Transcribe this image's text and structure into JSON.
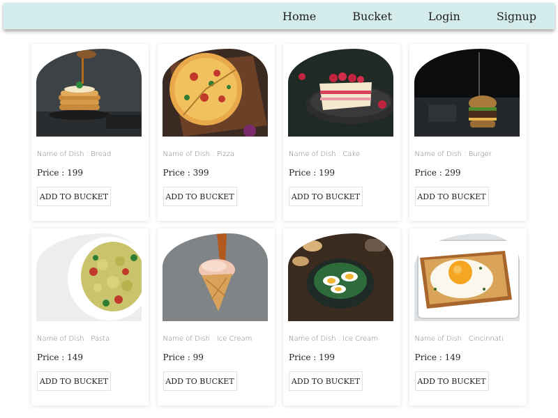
{
  "nav": {
    "home": "Home",
    "bucket": "Bucket",
    "login": "Login",
    "signup": "Signup"
  },
  "dishes": [
    {
      "name_label": "Name of Dish : Bread",
      "price_label": "Price : 199",
      "button_label": "ADD TO BUCKET",
      "image": "pancakes-photo"
    },
    {
      "name_label": "Name of Dish : Pizza",
      "price_label": "Price : 399",
      "button_label": "ADD TO BUCKET",
      "image": "pizza-photo"
    },
    {
      "name_label": "Name of Dish : Cake",
      "price_label": "Price : 199",
      "button_label": "ADD TO BUCKET",
      "image": "cake-photo"
    },
    {
      "name_label": "Name of Dish : Burger",
      "price_label": "Price : 299",
      "button_label": "ADD TO BUCKET",
      "image": "burger-photo"
    },
    {
      "name_label": "Name of Dish : Pasta",
      "price_label": "Price : 149",
      "button_label": "ADD TO BUCKET",
      "image": "pasta-photo"
    },
    {
      "name_label": "Name of Dish : Ice Cream",
      "price_label": "Price : 99",
      "button_label": "ADD TO BUCKET",
      "image": "ice-cream-photo"
    },
    {
      "name_label": "Name of Dish : Ice Cream",
      "price_label": "Price : 199",
      "button_label": "ADD TO BUCKET",
      "image": "salad-egg-photo"
    },
    {
      "name_label": "Name of Dish : Cincinnati",
      "price_label": "Price : 149",
      "button_label": "ADD TO BUCKET",
      "image": "egg-toast-photo"
    }
  ],
  "colors": {
    "navbar_bg": "#d4ecec",
    "page_bg": "#ffffff"
  }
}
